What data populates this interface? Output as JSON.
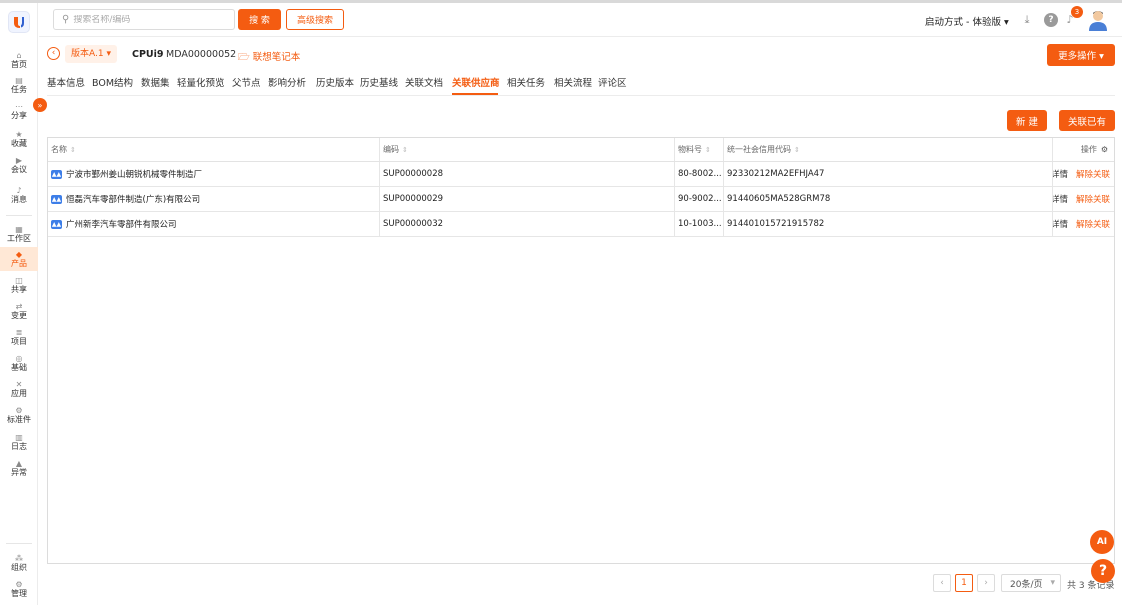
{
  "sidebar": {
    "items": [
      {
        "label": "首页",
        "icon": "home-icon",
        "glyph": "⌂"
      },
      {
        "label": "任务",
        "icon": "task-icon",
        "glyph": "▤"
      },
      {
        "label": "分享",
        "icon": "share-icon",
        "glyph": "⋯"
      },
      {
        "label": "收藏",
        "icon": "star-icon",
        "glyph": "★"
      },
      {
        "label": "会议",
        "icon": "video-icon",
        "glyph": "▶"
      },
      {
        "label": "消息",
        "icon": "bell-icon",
        "glyph": "♪"
      },
      {
        "label": "工作区",
        "icon": "workspace-icon",
        "glyph": "▦"
      },
      {
        "label": "产品",
        "icon": "product-icon",
        "glyph": "◆"
      },
      {
        "label": "共享",
        "icon": "shared-icon",
        "glyph": "◫"
      },
      {
        "label": "变更",
        "icon": "change-icon",
        "glyph": "⇄"
      },
      {
        "label": "项目",
        "icon": "project-icon",
        "glyph": "≣"
      },
      {
        "label": "基础",
        "icon": "base-icon",
        "glyph": "◎"
      },
      {
        "label": "应用",
        "icon": "apps-icon",
        "glyph": "✕"
      },
      {
        "label": "标准件",
        "icon": "gear-icon",
        "glyph": "⚙"
      },
      {
        "label": "日志",
        "icon": "log-icon",
        "glyph": "▥"
      },
      {
        "label": "异常",
        "icon": "warning-icon",
        "glyph": "▲"
      }
    ],
    "bottom": [
      {
        "label": "组织",
        "icon": "org-icon",
        "glyph": "⁂"
      },
      {
        "label": "管理",
        "icon": "settings-icon",
        "glyph": "⚙"
      }
    ],
    "expand_glyph": "»"
  },
  "topbar": {
    "search_placeholder": "搜索名称/编码",
    "search_button": "搜 索",
    "advanced_search": "高级搜索",
    "launch_mode": "启动方式 - 体验版 ▾",
    "notification_count": "3"
  },
  "header": {
    "version": "版本A.1 ▾",
    "product_name": "CPUi9",
    "product_code": "MDA00000052",
    "category": "🗁 联想笔记本",
    "more_actions": "更多操作 ▾"
  },
  "tabs": [
    {
      "label": "基本信息",
      "active": false
    },
    {
      "label": "BOM结构",
      "active": false
    },
    {
      "label": "数据集",
      "active": false
    },
    {
      "label": "轻量化预览",
      "active": false
    },
    {
      "label": "父节点",
      "active": false
    },
    {
      "label": "影响分析",
      "active": false
    },
    {
      "label": "历史版本",
      "active": false
    },
    {
      "label": "历史基线",
      "active": false
    },
    {
      "label": "关联文档",
      "active": false
    },
    {
      "label": "关联供应商",
      "active": true
    },
    {
      "label": "相关任务",
      "active": false
    },
    {
      "label": "相关流程",
      "active": false
    },
    {
      "label": "评论区",
      "active": false
    }
  ],
  "actions": {
    "new": "新 建",
    "link_existing": "关联已有"
  },
  "table": {
    "columns": [
      "名称",
      "编码",
      "物料号",
      "统一社会信用代码",
      "操作"
    ],
    "rows": [
      {
        "name": "宁波市鄞州姜山朝锐机械零件制造厂",
        "code": "SUP00000028",
        "material": "80-8002...",
        "credit": "92330212MA2EFHJA47"
      },
      {
        "name": "恒磊汽车零部件制造(广东)有限公司",
        "code": "SUP00000029",
        "material": "90-9002...",
        "credit": "91440605MA528GRM78"
      },
      {
        "name": "广州新李汽车零部件有限公司",
        "code": "SUP00000032",
        "material": "10-1003...",
        "credit": "914401015721915782"
      }
    ],
    "detail_label": "详情",
    "unlink_label": "解除关联"
  },
  "pagination": {
    "current_page": "1",
    "page_size": "20条/页",
    "total": "共 3 条记录"
  },
  "colors": {
    "accent": "#f45c11",
    "supplier_icon": "#3d7ee8"
  }
}
